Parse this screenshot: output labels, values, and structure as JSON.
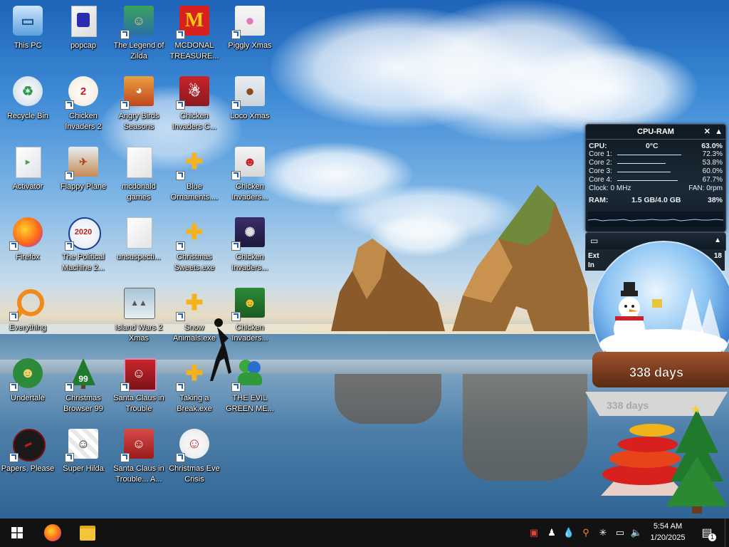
{
  "desktop": {
    "icons": [
      {
        "label": "This PC"
      },
      {
        "label": "popcap"
      },
      {
        "label": "The Legend of Zilda"
      },
      {
        "label": "MCDONAL TREASURE..."
      },
      {
        "label": "Piggly Xmas"
      },
      {
        "label": "Recycle Bin"
      },
      {
        "label": "Chicken Invaders 2"
      },
      {
        "label": "Angry Birds Seasons"
      },
      {
        "label": "Chicken Invaders C..."
      },
      {
        "label": "Loco Xmas"
      },
      {
        "label": "Activator"
      },
      {
        "label": "Flappy Plane"
      },
      {
        "label": "mcdonald games"
      },
      {
        "label": "Blue Ornaments...."
      },
      {
        "label": "Chicken Invaders..."
      },
      {
        "label": "Firefox"
      },
      {
        "label": "The Political Machine 2..."
      },
      {
        "label": "unsuspecti..."
      },
      {
        "label": "Christmas Sweets.exe"
      },
      {
        "label": "Chicken Invaders..."
      },
      {
        "label": "Everything"
      },
      {
        "label": "Island Wars 2 Xmas"
      },
      {
        "label": "Snow Animals.exe"
      },
      {
        "label": "Chicken Invaders..."
      },
      {
        "label": "Undertale"
      },
      {
        "label": "Christmas Browser 99"
      },
      {
        "label": "Santa Claus in Trouble"
      },
      {
        "label": "Taking a Break.exe"
      },
      {
        "label": "THE EVIL GREEN ME..."
      },
      {
        "label": "Papers, Please"
      },
      {
        "label": "Super Hilda"
      },
      {
        "label": "Santa Claus in Trouble... A..."
      },
      {
        "label": "Christmas Eve Crisis"
      }
    ],
    "icon_badges": {
      "political": "2020",
      "browser": "99"
    }
  },
  "cpu_gadget": {
    "title": "CPU-RAM",
    "cpu_label": "CPU:",
    "cpu_temp": "0°C",
    "cpu_pct": "63.0%",
    "cores": [
      {
        "label": "Core 1:",
        "pct": "72.3%",
        "level": 0.72
      },
      {
        "label": "Core 2:",
        "pct": "53.8%",
        "level": 0.54
      },
      {
        "label": "Core 3:",
        "pct": "60.0%",
        "level": 0.6
      },
      {
        "label": "Core 4:",
        "pct": "67.7%",
        "level": 0.68
      }
    ],
    "clock": "Clock: 0 MHz",
    "fan": "FAN: 0rpm",
    "ram_label": "RAM:",
    "ram_used": "1.5 GB/4.0 GB",
    "ram_pct": "38%"
  },
  "net_gadget": {
    "partial_line1": "Ext",
    "partial_num": "18",
    "partial_line2": "In"
  },
  "snow_globe": {
    "days_main": "338 days",
    "days_base": "338 days"
  },
  "taskbar": {
    "time": "5:54 AM",
    "date": "1/20/2025",
    "notification_count": "1",
    "pinned": [
      "Firefox",
      "File Explorer"
    ]
  },
  "colors": {
    "taskbar": "#121212",
    "accent": "#1b5fbf",
    "gadget_bg": "#142430"
  }
}
